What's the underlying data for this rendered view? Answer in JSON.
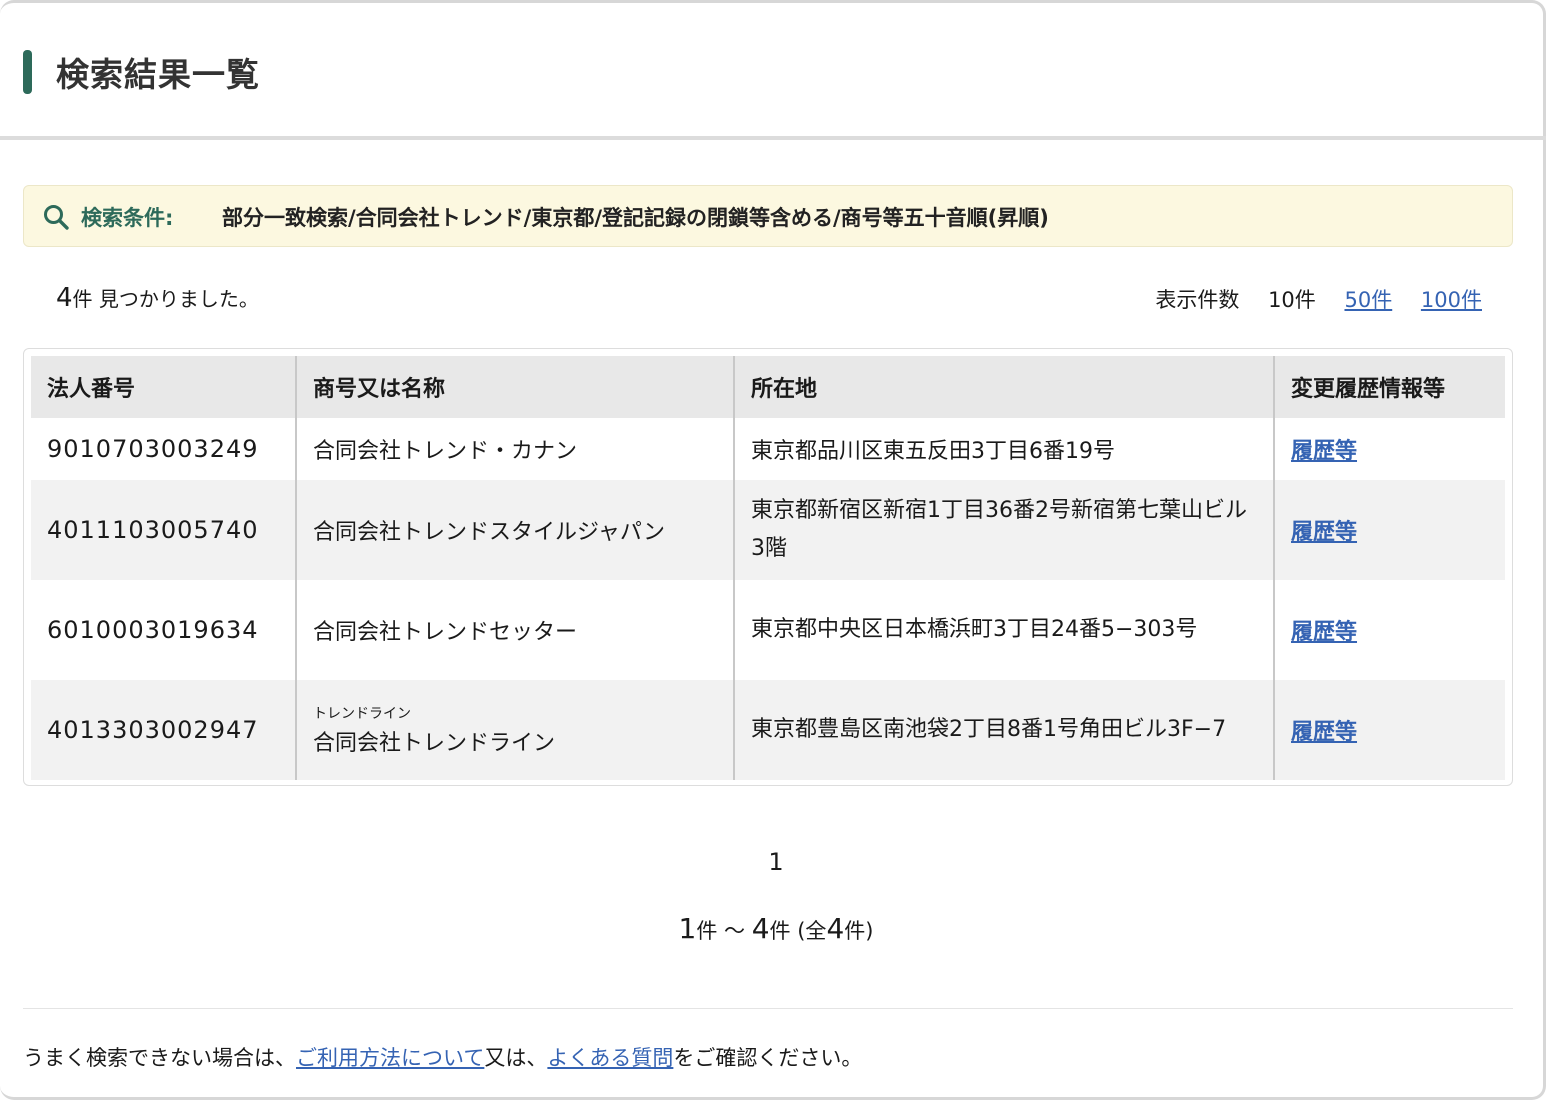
{
  "page": {
    "title": "検索結果一覧"
  },
  "condition": {
    "label": "検索条件:",
    "value": "部分一致検索/合同会社トレンド/東京都/登記記録の閉鎖等含める/商号等五十音順(昇順)"
  },
  "results": {
    "count": "4",
    "count_unit": "件",
    "found_text": "見つかりました。"
  },
  "per_page": {
    "label": "表示件数",
    "current": "10件",
    "options": [
      "50件",
      "100件"
    ]
  },
  "table": {
    "headers": [
      "法人番号",
      "商号又は名称",
      "所在地",
      "変更履歴情報等"
    ],
    "rows": [
      {
        "number": "9010703003249",
        "furigana": "",
        "name": "合同会社トレンド・カナン",
        "address": "東京都品川区東五反田3丁目6番19号",
        "history": "履歴等"
      },
      {
        "number": "4011103005740",
        "furigana": "",
        "name": "合同会社トレンドスタイルジャパン",
        "address": "東京都新宿区新宿1丁目36番2号新宿第七葉山ビル3階",
        "history": "履歴等"
      },
      {
        "number": "6010003019634",
        "furigana": "",
        "name": "合同会社トレンドセッター",
        "address": "東京都中央区日本橋浜町3丁目24番5−303号",
        "history": "履歴等"
      },
      {
        "number": "4013303002947",
        "furigana": "トレンドライン",
        "name": "合同会社トレンドライン",
        "address": "東京都豊島区南池袋2丁目8番1号角田ビル3F−7",
        "history": "履歴等"
      }
    ]
  },
  "pagination": {
    "current_page": "1",
    "range_start": "1",
    "range_end": "4",
    "total": "4",
    "unit": "件",
    "tilde": "～",
    "total_prefix": "(全",
    "total_suffix": "件)"
  },
  "footer": {
    "text_before": "うまく検索できない場合は、",
    "link1": "ご利用方法について",
    "text_middle": "又は、",
    "link2": "よくある質問",
    "text_after": "をご確認ください。"
  },
  "colors": {
    "accent": "#2d6a5a",
    "link": "#3563b3",
    "condition_bg": "#fcf8e0"
  }
}
